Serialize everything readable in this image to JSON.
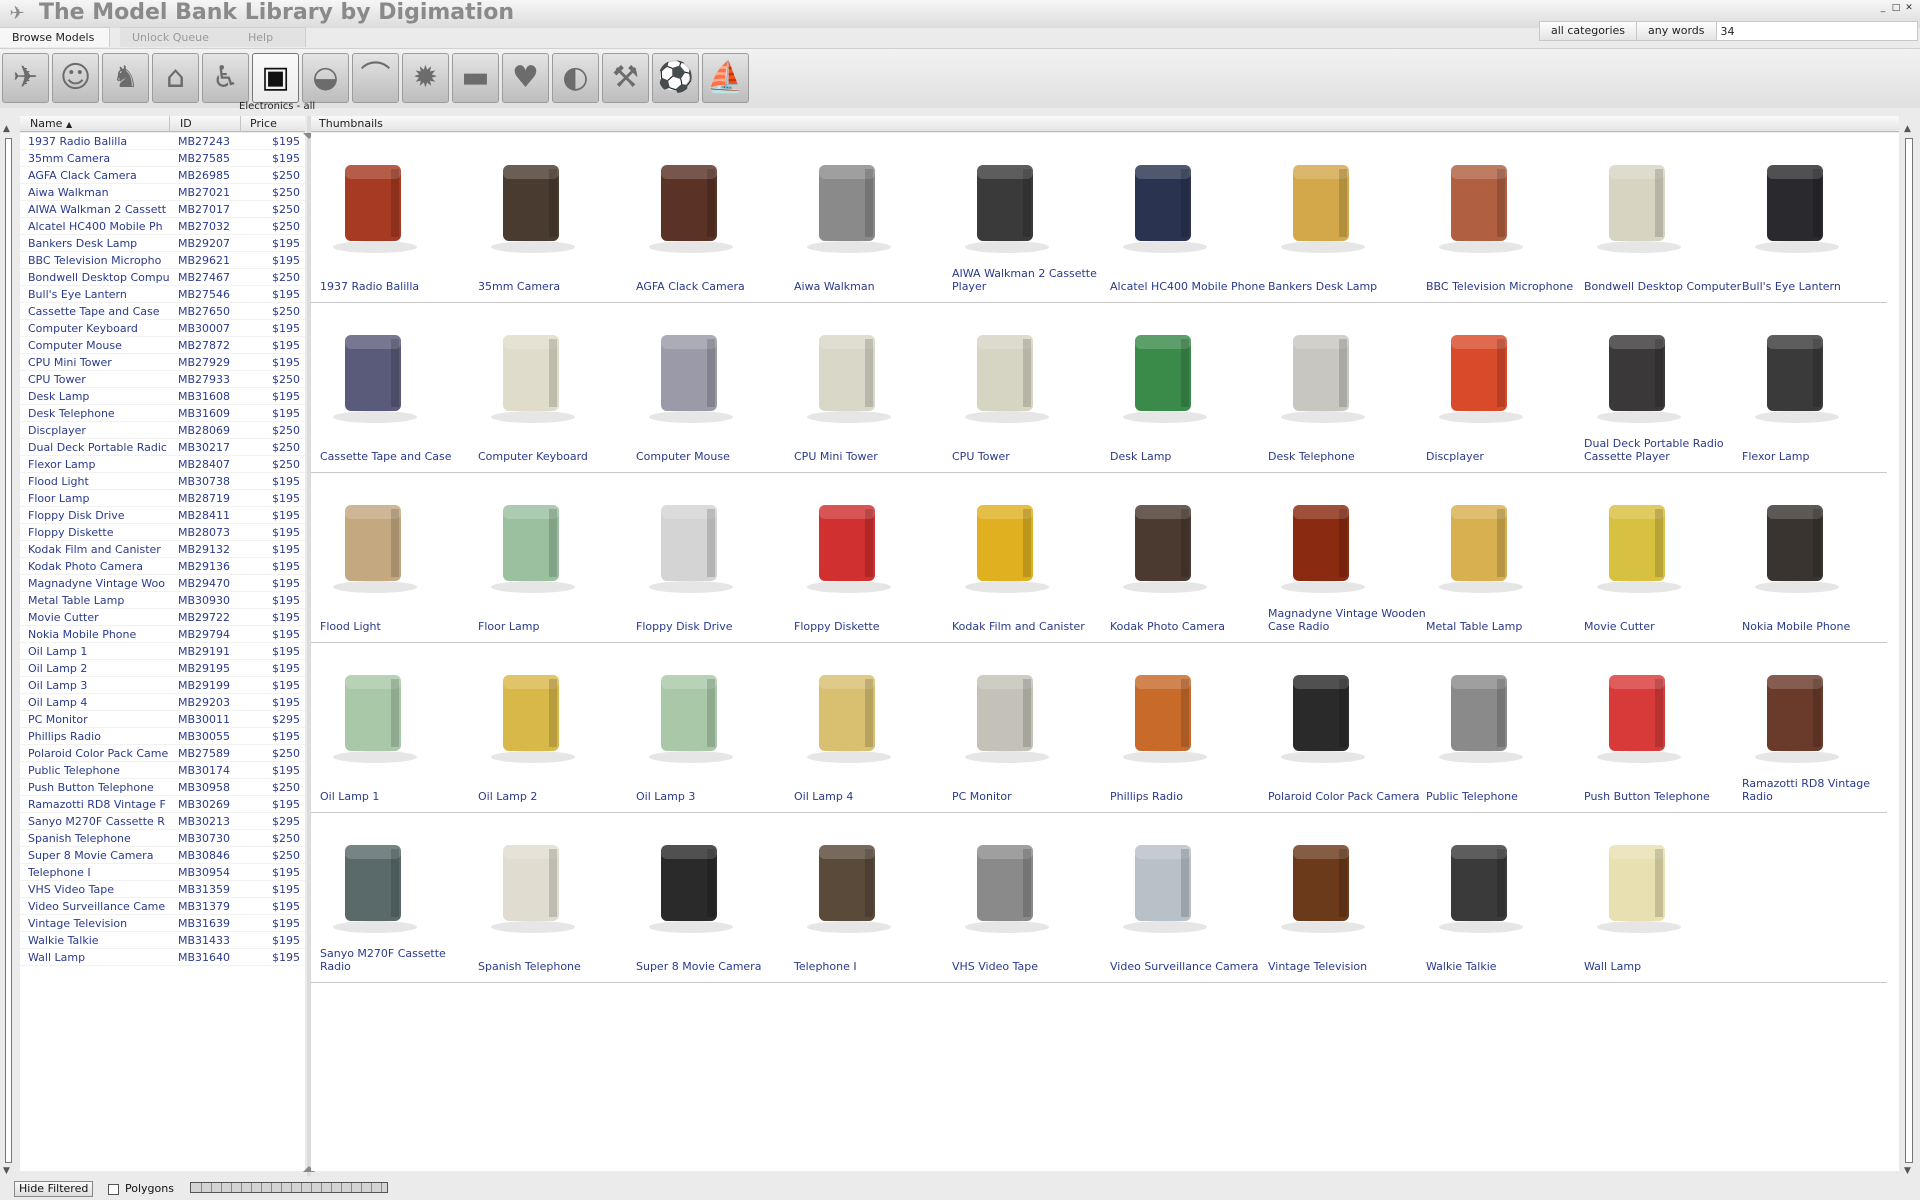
{
  "window": {
    "title": "The Model Bank Library by Digimation"
  },
  "search": {
    "category": "all categories",
    "mode": "any words",
    "query": "34"
  },
  "tabs": [
    "Browse Models",
    "Unlock Queue",
    "Help"
  ],
  "categories": [
    {
      "name": "Aircraft",
      "icon": "airplane-icon",
      "glyph": "✈"
    },
    {
      "name": "Characters",
      "icon": "head-icon",
      "glyph": "☺"
    },
    {
      "name": "Animals",
      "icon": "horse-icon",
      "glyph": "♞"
    },
    {
      "name": "Architecture",
      "icon": "building-icon",
      "glyph": "⌂"
    },
    {
      "name": "People",
      "icon": "runner-icon",
      "glyph": "♿"
    },
    {
      "name": "Electronics",
      "icon": "boombox-icon",
      "glyph": "▣"
    },
    {
      "name": "Vehicles",
      "icon": "car-icon",
      "glyph": "◒"
    },
    {
      "name": "Clothing",
      "icon": "hanger-icon",
      "glyph": "⌒"
    },
    {
      "name": "Industrial",
      "icon": "gear-icon",
      "glyph": "✹"
    },
    {
      "name": "Military",
      "icon": "tank-icon",
      "glyph": "▬"
    },
    {
      "name": "Food",
      "icon": "strawberry-icon",
      "glyph": "♥"
    },
    {
      "name": "Medical",
      "icon": "pill-icon",
      "glyph": "◐"
    },
    {
      "name": "Household",
      "icon": "tools-icon",
      "glyph": "⚒"
    },
    {
      "name": "Sports",
      "icon": "soccer-ball-icon",
      "glyph": "⚽"
    },
    {
      "name": "Watercraft",
      "icon": "sailboat-icon",
      "glyph": "⛵"
    }
  ],
  "selected_category_label": "Electronics - all",
  "list": {
    "columns": [
      "Name",
      "ID",
      "Price"
    ],
    "sort_indicator": "▲",
    "rows": [
      {
        "name": "1937 Radio Balilla",
        "id": "MB27243",
        "price": "$195"
      },
      {
        "name": "35mm Camera",
        "id": "MB27585",
        "price": "$195"
      },
      {
        "name": "AGFA Clack Camera",
        "id": "MB26985",
        "price": "$250"
      },
      {
        "name": "Aiwa Walkman",
        "id": "MB27021",
        "price": "$250"
      },
      {
        "name": "AIWA Walkman 2 Cassett",
        "id": "MB27017",
        "price": "$250"
      },
      {
        "name": "Alcatel HC400 Mobile Ph",
        "id": "MB27032",
        "price": "$250"
      },
      {
        "name": "Bankers Desk Lamp",
        "id": "MB29207",
        "price": "$195"
      },
      {
        "name": "BBC Television Micropho",
        "id": "MB29621",
        "price": "$195"
      },
      {
        "name": "Bondwell Desktop Compu",
        "id": "MB27467",
        "price": "$250"
      },
      {
        "name": "Bull's Eye Lantern",
        "id": "MB27546",
        "price": "$195"
      },
      {
        "name": "Cassette Tape and Case",
        "id": "MB27650",
        "price": "$250"
      },
      {
        "name": "Computer Keyboard",
        "id": "MB30007",
        "price": "$195"
      },
      {
        "name": "Computer Mouse",
        "id": "MB27872",
        "price": "$195"
      },
      {
        "name": "CPU Mini Tower",
        "id": "MB27929",
        "price": "$195"
      },
      {
        "name": "CPU Tower",
        "id": "MB27933",
        "price": "$250"
      },
      {
        "name": "Desk Lamp",
        "id": "MB31608",
        "price": "$195"
      },
      {
        "name": "Desk Telephone",
        "id": "MB31609",
        "price": "$195"
      },
      {
        "name": "Discplayer",
        "id": "MB28069",
        "price": "$250"
      },
      {
        "name": "Dual Deck Portable Radic",
        "id": "MB30217",
        "price": "$250"
      },
      {
        "name": "Flexor Lamp",
        "id": "MB28407",
        "price": "$250"
      },
      {
        "name": "Flood Light",
        "id": "MB30738",
        "price": "$195"
      },
      {
        "name": "Floor Lamp",
        "id": "MB28719",
        "price": "$195"
      },
      {
        "name": "Floppy Disk Drive",
        "id": "MB28411",
        "price": "$195"
      },
      {
        "name": "Floppy Diskette",
        "id": "MB28073",
        "price": "$195"
      },
      {
        "name": "Kodak Film and Canister",
        "id": "MB29132",
        "price": "$195"
      },
      {
        "name": "Kodak Photo Camera",
        "id": "MB29136",
        "price": "$195"
      },
      {
        "name": "Magnadyne Vintage Woo",
        "id": "MB29470",
        "price": "$195"
      },
      {
        "name": "Metal Table Lamp",
        "id": "MB30930",
        "price": "$195"
      },
      {
        "name": "Movie Cutter",
        "id": "MB29722",
        "price": "$195"
      },
      {
        "name": "Nokia Mobile Phone",
        "id": "MB29794",
        "price": "$195"
      },
      {
        "name": "Oil Lamp 1",
        "id": "MB29191",
        "price": "$195"
      },
      {
        "name": "Oil Lamp 2",
        "id": "MB29195",
        "price": "$195"
      },
      {
        "name": "Oil Lamp 3",
        "id": "MB29199",
        "price": "$195"
      },
      {
        "name": "Oil Lamp 4",
        "id": "MB29203",
        "price": "$195"
      },
      {
        "name": "PC Monitor",
        "id": "MB30011",
        "price": "$295"
      },
      {
        "name": "Phillips Radio",
        "id": "MB30055",
        "price": "$195"
      },
      {
        "name": "Polaroid Color Pack Came",
        "id": "MB27589",
        "price": "$250"
      },
      {
        "name": "Public Telephone",
        "id": "MB30174",
        "price": "$195"
      },
      {
        "name": "Push Button Telephone",
        "id": "MB30958",
        "price": "$250"
      },
      {
        "name": "Ramazotti RD8 Vintage F",
        "id": "MB30269",
        "price": "$195"
      },
      {
        "name": "Sanyo M270F Cassette R",
        "id": "MB30213",
        "price": "$295"
      },
      {
        "name": "Spanish Telephone",
        "id": "MB30730",
        "price": "$250"
      },
      {
        "name": "Super 8 Movie Camera",
        "id": "MB30846",
        "price": "$250"
      },
      {
        "name": "Telephone I",
        "id": "MB30954",
        "price": "$195"
      },
      {
        "name": "VHS Video Tape",
        "id": "MB31359",
        "price": "$195"
      },
      {
        "name": "Video Surveillance Came",
        "id": "MB31379",
        "price": "$195"
      },
      {
        "name": "Vintage Television",
        "id": "MB31639",
        "price": "$195"
      },
      {
        "name": "Walkie Talkie",
        "id": "MB31433",
        "price": "$195"
      },
      {
        "name": "Wall Lamp",
        "id": "MB31640",
        "price": "$195"
      }
    ]
  },
  "thumbnails": {
    "header": "Thumbnails",
    "items": [
      {
        "label": "1937 Radio Balilla",
        "color": "#a63a22"
      },
      {
        "label": "35mm Camera",
        "color": "#4a3b30"
      },
      {
        "label": "AGFA Clack Camera",
        "color": "#5a3226"
      },
      {
        "label": "Aiwa Walkman",
        "color": "#8a8a8a"
      },
      {
        "label": "AIWA Walkman 2 Cassette Player",
        "color": "#3a3a3a"
      },
      {
        "label": "Alcatel HC400 Mobile Phone",
        "color": "#2a3450"
      },
      {
        "label": "Bankers Desk Lamp",
        "color": "#d2a84a"
      },
      {
        "label": "BBC Television Microphone",
        "color": "#b06040"
      },
      {
        "label": "Bondwell Desktop Computer",
        "color": "#d8d4c2"
      },
      {
        "label": "Bull's Eye Lantern",
        "color": "#2a2a2e"
      },
      {
        "label": "Cassette Tape and Case",
        "color": "#5a5a7a"
      },
      {
        "label": "Computer Keyboard",
        "color": "#e0dccb"
      },
      {
        "label": "Computer Mouse",
        "color": "#9a9aa8"
      },
      {
        "label": "CPU Mini Tower",
        "color": "#d9d7c7"
      },
      {
        "label": "CPU Tower",
        "color": "#d6d4c2"
      },
      {
        "label": "Desk Lamp",
        "color": "#3a8a4a"
      },
      {
        "label": "Desk Telephone",
        "color": "#c8c6c0"
      },
      {
        "label": "Discplayer",
        "color": "#d84a2a"
      },
      {
        "label": "Dual Deck Portable Radio Cassette Player",
        "color": "#3a3838"
      },
      {
        "label": "Flexor Lamp",
        "color": "#3a3a3a"
      },
      {
        "label": "Flood Light",
        "color": "#c4a880"
      },
      {
        "label": "Floor Lamp",
        "color": "#9ac0a0"
      },
      {
        "label": "Floppy Disk Drive",
        "color": "#d4d4d4"
      },
      {
        "label": "Floppy Diskette",
        "color": "#d03030"
      },
      {
        "label": "Kodak Film and Canister",
        "color": "#e0b020"
      },
      {
        "label": "Kodak Photo Camera",
        "color": "#4a3a30"
      },
      {
        "label": "Magnadyne Vintage Wooden Case Radio",
        "color": "#8a2a10"
      },
      {
        "label": "Metal Table Lamp",
        "color": "#d8b050"
      },
      {
        "label": "Movie Cutter",
        "color": "#d8c040"
      },
      {
        "label": "Nokia Mobile Phone",
        "color": "#3a3430"
      },
      {
        "label": "Oil Lamp 1",
        "color": "#a8c8a8"
      },
      {
        "label": "Oil Lamp 2",
        "color": "#d8b848"
      },
      {
        "label": "Oil Lamp 3",
        "color": "#a8c8a8"
      },
      {
        "label": "Oil Lamp 4",
        "color": "#d8c070"
      },
      {
        "label": "PC Monitor",
        "color": "#c4c2b8"
      },
      {
        "label": "Phillips Radio",
        "color": "#c86a2a"
      },
      {
        "label": "Polaroid Color Pack Camera",
        "color": "#2a2a2a"
      },
      {
        "label": "Public Telephone",
        "color": "#8a8a8a"
      },
      {
        "label": "Push Button Telephone",
        "color": "#d83a3a"
      },
      {
        "label": "Ramazotti RD8 Vintage Radio",
        "color": "#6a3a2a"
      },
      {
        "label": "Sanyo M270F Cassette Radio",
        "color": "#5a6a6a"
      },
      {
        "label": "Spanish Telephone",
        "color": "#e0dcd0"
      },
      {
        "label": "Super 8 Movie Camera",
        "color": "#2a2a2a"
      },
      {
        "label": "Telephone I",
        "color": "#5a4a3a"
      },
      {
        "label": "VHS Video Tape",
        "color": "#8a8a8a"
      },
      {
        "label": "Video Surveillance Camera",
        "color": "#b8c0c8"
      },
      {
        "label": "Vintage Television",
        "color": "#6a3a1a"
      },
      {
        "label": "Walkie Talkie",
        "color": "#3a3a3a"
      },
      {
        "label": "Wall Lamp",
        "color": "#e8e0b0"
      }
    ]
  },
  "statusbar": {
    "hide_filtered": "Hide Filtered",
    "polygons_label": "Polygons"
  }
}
